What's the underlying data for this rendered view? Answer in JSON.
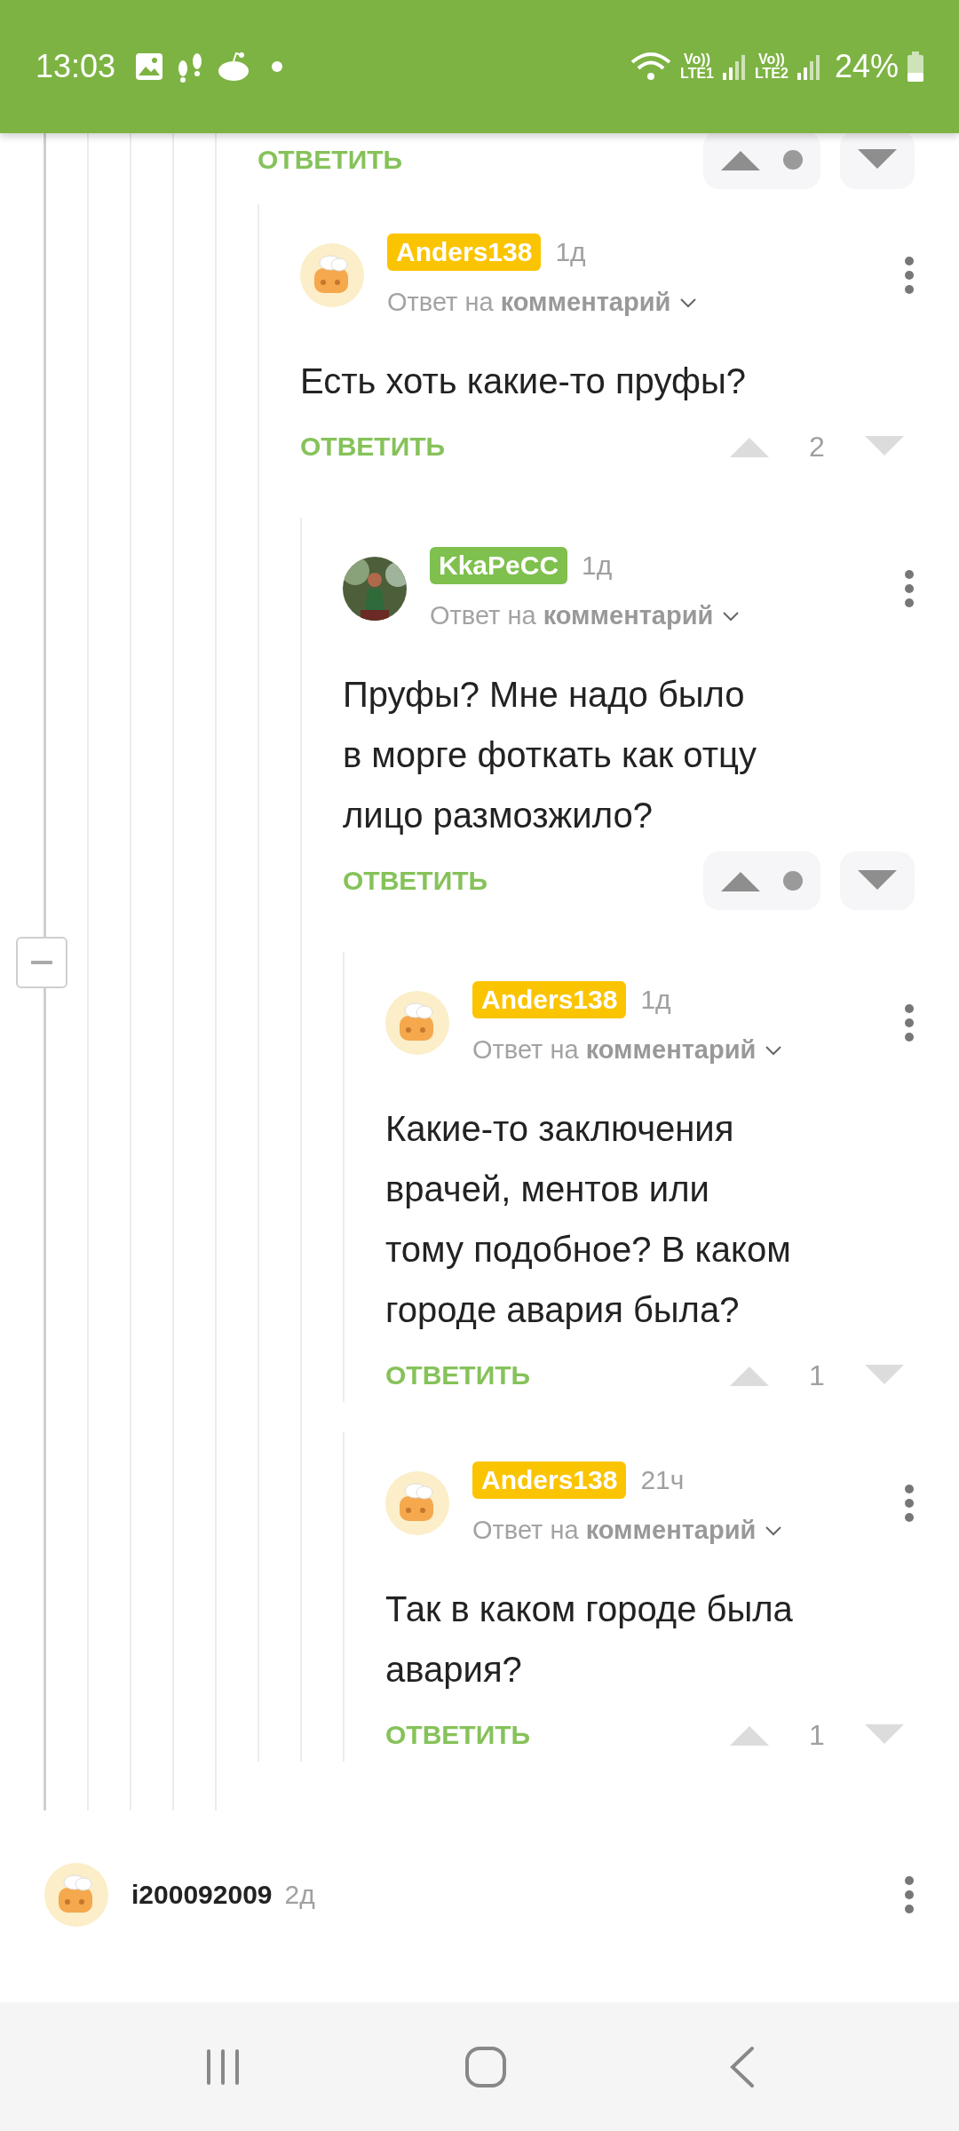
{
  "status_bar": {
    "time": "13:03",
    "sims": [
      {
        "volte": "Vo))",
        "network": "LTE1"
      },
      {
        "volte": "Vo))",
        "network": "LTE2"
      }
    ],
    "battery": "24%"
  },
  "thread": {
    "collapse_control": {
      "expanded": true
    },
    "partial_comment": {
      "reply": "ОТВЕТИТЬ",
      "votes": {
        "kind": "hidden"
      }
    },
    "comments": [
      {
        "avatar": {
          "kind": "cartoon"
        },
        "author": {
          "name": "Anders138",
          "color": "#fbc400"
        },
        "time": "1д",
        "reply_to": "Ответ на **комментарий**",
        "text": "Есть хоть какие-то пруфы?",
        "reply": "ОТВЕТИТЬ",
        "votes": {
          "kind": "score",
          "rating": "2"
        },
        "children": [
          {
            "author": {
              "name": "KkaPeCC",
              "color": "#7fc04e"
            },
            "time": "1д",
            "reply_to": "Ответ на **комментарий**",
            "text": "Пруфы? Мне надо было\nв морге фоткать как отцу\nлицо размозжило?",
            "reply": "ОТВЕТИТЬ",
            "votes": {
              "kind": "hidden"
            },
            "children": [
              {
                "avatar": {
                  "kind": "cartoon"
                },
                "author": {
                  "name": "Anders138",
                  "color": "#fbc400"
                },
                "time": "1д",
                "reply_to": "Ответ на **комментарий**",
                "text": "Какие-то заключения\nврачей, ментов или\nтому подобное? В каком\nгороде авария была?",
                "reply": "ОТВЕТИТЬ",
                "votes": {
                  "kind": "score",
                  "rating": "1"
                }
              },
              {
                "avatar": {
                  "kind": "cartoon"
                },
                "author": {
                  "name": "Anders138",
                  "color": "#fbc400"
                },
                "time": "21ч",
                "reply_to": "Ответ на **комментарий**",
                "text": "Так в каком городе была\nавария?",
                "reply": "ОТВЕТИТЬ",
                "votes": {
                  "kind": "score",
                  "rating": "1"
                }
              }
            ]
          }
        ]
      }
    ]
  },
  "bottom_comment": {
    "avatar": {
      "kind": "cartoon"
    },
    "author": {
      "name": "i200092009"
    },
    "time": "2д"
  }
}
